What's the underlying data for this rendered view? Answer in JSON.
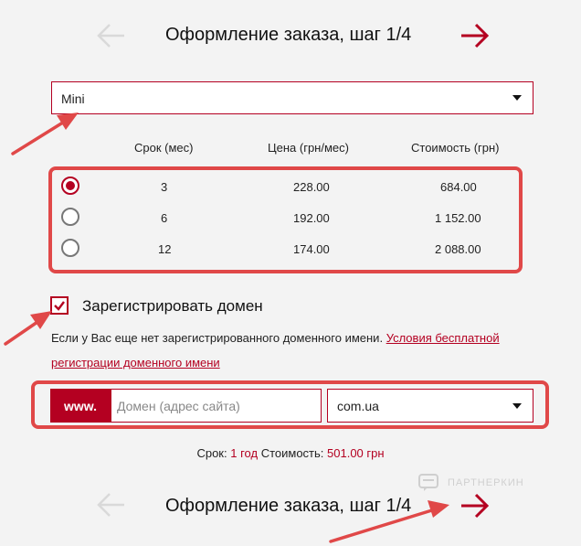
{
  "header": {
    "title": "Оформление заказа, шаг 1/4"
  },
  "footer": {
    "title": "Оформление заказа, шаг 1/4"
  },
  "plan_select": {
    "value": "Mini"
  },
  "table": {
    "columns": [
      "Срок (мес)",
      "Цена (грн/мес)",
      "Стоимость (грн)"
    ],
    "rows": [
      {
        "term": "3",
        "price": "228.00",
        "cost": "684.00",
        "selected": true
      },
      {
        "term": "6",
        "price": "192.00",
        "cost": "1 152.00",
        "selected": false
      },
      {
        "term": "12",
        "price": "174.00",
        "cost": "2 088.00",
        "selected": false
      }
    ]
  },
  "register_domain": {
    "label": "Зарегистрировать домен",
    "checked": true,
    "note_text": "Если у Вас еще нет зарегистрированного доменного имени. ",
    "note_link": "Условия бесплатной регистрации доменного имени"
  },
  "domain": {
    "prefix": "www.",
    "placeholder": "Домен (адрес сайта)",
    "zone": "com.ua"
  },
  "summary": {
    "term_label": "Срок:",
    "term_value": "1 год",
    "cost_label": "Стоимость:",
    "cost_value": "501.00 грн"
  },
  "watermark": {
    "text": "ПАРТНЕРКИН"
  },
  "colors": {
    "accent": "#b40021",
    "highlight_red": "#e04848",
    "arrow_disabled": "#d9d9d9",
    "background": "#f3f3f3"
  }
}
